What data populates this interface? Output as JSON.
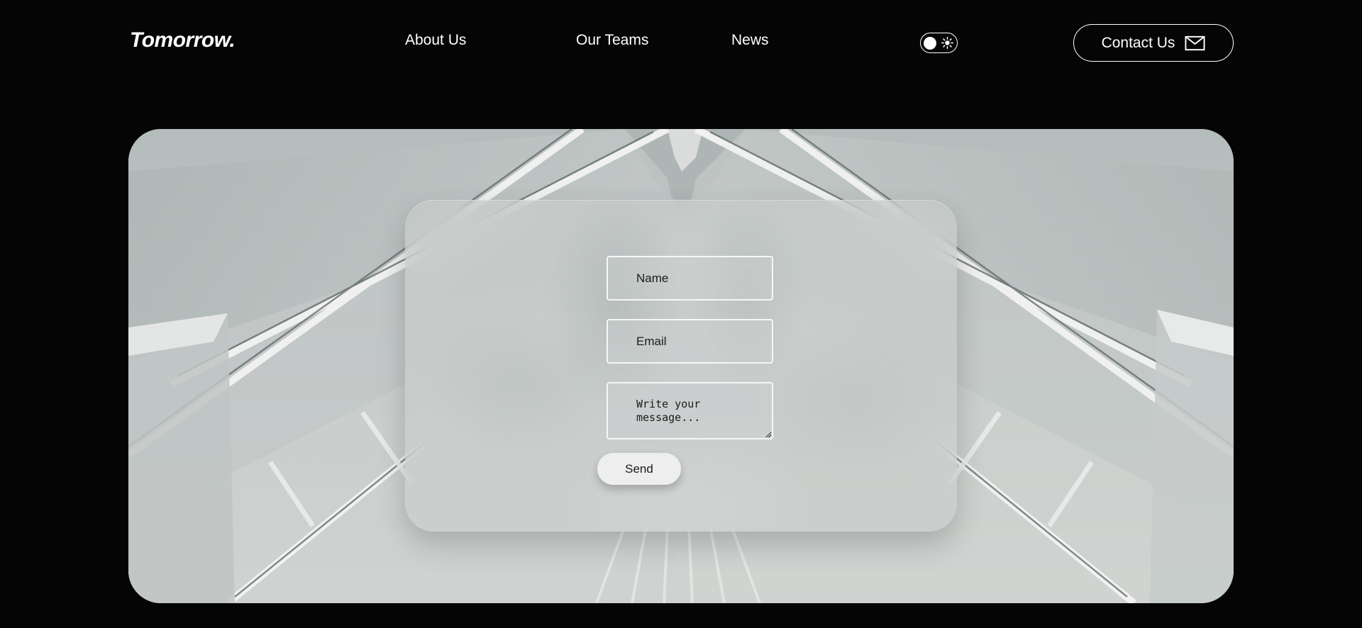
{
  "brand": {
    "logo_text": "Tomorrow."
  },
  "nav": {
    "items": [
      {
        "label": "About Us"
      },
      {
        "label": "Our Teams"
      },
      {
        "label": "News"
      }
    ]
  },
  "theme_toggle": {
    "state": "light",
    "icon": "sun-icon"
  },
  "header": {
    "contact_label": "Contact Us",
    "contact_icon": "mail-icon"
  },
  "form": {
    "name_placeholder": "Name",
    "email_placeholder": "Email",
    "message_placeholder": "Write your message...",
    "send_label": "Send"
  },
  "colors": {
    "page_background": "#050505",
    "header_text": "#ffffff",
    "field_border": "#f6f7f6",
    "button_background": "#eeeeee"
  }
}
